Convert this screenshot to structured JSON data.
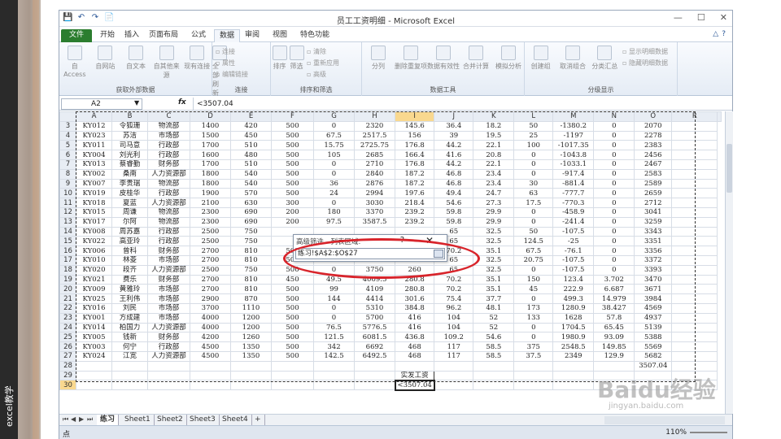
{
  "side": {
    "caption": "excel教学"
  },
  "window": {
    "title": "员工工资明细 - Microsoft Excel",
    "controls": [
      "—",
      "☐",
      "✕"
    ]
  },
  "qat": [
    "💾",
    "↶",
    "↷",
    "📄"
  ],
  "tabs": [
    {
      "label": "文件",
      "style": "file"
    },
    {
      "label": "开始"
    },
    {
      "label": "插入"
    },
    {
      "label": "页面布局"
    },
    {
      "label": "公式"
    },
    {
      "label": "数据",
      "active": true
    },
    {
      "label": "审阅"
    },
    {
      "label": "视图"
    },
    {
      "label": "特色功能"
    }
  ],
  "ribbon": {
    "groups": [
      {
        "label": "获取外部数据",
        "buttons": [
          "自 Access",
          "自网站",
          "自文本",
          "自其他来源",
          "现有连接"
        ]
      },
      {
        "label": "连接",
        "buttons": [
          "全部刷新"
        ],
        "small": [
          "连接",
          "属性",
          "编辑链接"
        ]
      },
      {
        "label": "排序和筛选",
        "buttons": [
          "排序",
          "筛选"
        ],
        "small": [
          "清除",
          "重新应用",
          "高级"
        ]
      },
      {
        "label": "数据工具",
        "buttons": [
          "分列",
          "删除重复项",
          "数据有效性",
          "合并计算",
          "模拟分析"
        ]
      },
      {
        "label": "分级显示",
        "buttons": [
          "创建组",
          "取消组合",
          "分类汇总"
        ],
        "small": [
          "显示明细数据",
          "隐藏明细数据"
        ]
      }
    ]
  },
  "formula_bar": {
    "name_box": "A2",
    "fx": "fx",
    "content": "<3507.04"
  },
  "columns": [
    "A",
    "B",
    "C",
    "D",
    "E",
    "F",
    "G",
    "H",
    "I",
    "J",
    "K",
    "L",
    "M",
    "N",
    "O",
    "R"
  ],
  "rows": [
    {
      "n": "3",
      "c": [
        "KY012",
        "令狐珊",
        "物流部",
        "1400",
        "420",
        "500",
        "0",
        "2320",
        "145.6",
        "36.4",
        "18.2",
        "50",
        "-1380.2",
        "0",
        "2070"
      ]
    },
    {
      "n": "4",
      "c": [
        "KY023",
        "苏洁",
        "市场部",
        "1500",
        "450",
        "500",
        "67.5",
        "2517.5",
        "156",
        "39",
        "19.5",
        "25",
        "-1197",
        "0",
        "2278"
      ]
    },
    {
      "n": "5",
      "c": [
        "KY011",
        "司马意",
        "行政部",
        "1700",
        "510",
        "500",
        "15.75",
        "2725.75",
        "176.8",
        "44.2",
        "22.1",
        "100",
        "-1017.35",
        "0",
        "2383"
      ]
    },
    {
      "n": "6",
      "c": [
        "KY004",
        "刘光利",
        "行政部",
        "1600",
        "480",
        "500",
        "105",
        "2685",
        "166.4",
        "41.6",
        "20.8",
        "0",
        "-1043.8",
        "0",
        "2456"
      ]
    },
    {
      "n": "7",
      "c": [
        "KY013",
        "蔡睿勤",
        "财务部",
        "1700",
        "510",
        "500",
        "0",
        "2710",
        "176.8",
        "44.2",
        "22.1",
        "0",
        "-1033.1",
        "0",
        "2467"
      ]
    },
    {
      "n": "8",
      "c": [
        "KY002",
        "桑南",
        "人力资源部",
        "1800",
        "540",
        "500",
        "0",
        "2840",
        "187.2",
        "46.8",
        "23.4",
        "0",
        "-917.4",
        "0",
        "2583"
      ]
    },
    {
      "n": "9",
      "c": [
        "KY007",
        "李贵瑞",
        "物流部",
        "1800",
        "540",
        "500",
        "36",
        "2876",
        "187.2",
        "46.8",
        "23.4",
        "30",
        "-881.4",
        "0",
        "2589"
      ]
    },
    {
      "n": "10",
      "c": [
        "KY019",
        "皮桂华",
        "行政部",
        "1900",
        "570",
        "500",
        "24",
        "2994",
        "197.6",
        "49.4",
        "24.7",
        "63",
        "-777.7",
        "0",
        "2659"
      ]
    },
    {
      "n": "11",
      "c": [
        "KY018",
        "夏蓝",
        "人力资源部",
        "2100",
        "630",
        "300",
        "0",
        "3030",
        "218.4",
        "54.6",
        "27.3",
        "17.5",
        "-770.3",
        "0",
        "2712"
      ]
    },
    {
      "n": "12",
      "c": [
        "KY015",
        "周谦",
        "物流部",
        "2300",
        "690",
        "200",
        "180",
        "3370",
        "239.2",
        "59.8",
        "29.9",
        "0",
        "-458.9",
        "0",
        "3041"
      ]
    },
    {
      "n": "13",
      "c": [
        "KY017",
        "尔阿",
        "物流部",
        "2300",
        "690",
        "200",
        "97.5",
        "3587.5",
        "239.2",
        "59.8",
        "29.9",
        "0",
        "-241.4",
        "0",
        "3259"
      ]
    },
    {
      "n": "14",
      "c": [
        "KY008",
        "周苏嘉",
        "行政部",
        "2500",
        "750",
        "",
        "",
        "",
        "",
        "65",
        "32.5",
        "50",
        "-107.5",
        "0",
        "3343"
      ]
    },
    {
      "n": "15",
      "c": [
        "KY022",
        "高亚玲",
        "行政部",
        "2500",
        "750",
        "",
        "",
        "",
        "",
        "65",
        "32.5",
        "124.5",
        "-25",
        "0",
        "3351"
      ]
    },
    {
      "n": "16",
      "c": [
        "KY006",
        "曾科",
        "财务部",
        "2700",
        "810",
        "500",
        "0",
        "3510",
        "280.8",
        "70.2",
        "35.1",
        "67.5",
        "-76.1",
        "0",
        "3356"
      ]
    },
    {
      "n": "17",
      "c": [
        "KY010",
        "林菱",
        "市场部",
        "2700",
        "810",
        "500",
        "0",
        "3750",
        "280.8",
        "65",
        "32.5",
        "20.75",
        "-107.5",
        "0",
        "3372"
      ]
    },
    {
      "n": "18",
      "c": [
        "KY020",
        "段齐",
        "人力资源部",
        "2500",
        "750",
        "500",
        "0",
        "3750",
        "260",
        "65",
        "32.5",
        "0",
        "-107.5",
        "0",
        "3393"
      ]
    },
    {
      "n": "19",
      "c": [
        "KY021",
        "费乐",
        "财务部",
        "2700",
        "810",
        "450",
        "49.5",
        "4009.5",
        "280.8",
        "70.2",
        "35.1",
        "150",
        "123.4",
        "3.702",
        "3470"
      ]
    },
    {
      "n": "20",
      "c": [
        "KY009",
        "黄雅玲",
        "市场部",
        "2700",
        "810",
        "500",
        "99",
        "4109",
        "280.8",
        "70.2",
        "35.1",
        "45",
        "222.9",
        "6.687",
        "3671"
      ]
    },
    {
      "n": "21",
      "c": [
        "KY025",
        "王利伟",
        "市场部",
        "2900",
        "870",
        "500",
        "144",
        "4414",
        "301.6",
        "75.4",
        "37.7",
        "0",
        "499.3",
        "14.979",
        "3984"
      ]
    },
    {
      "n": "22",
      "c": [
        "KY016",
        "刘民",
        "市场部",
        "3700",
        "1110",
        "500",
        "0",
        "5310",
        "384.8",
        "96.2",
        "48.1",
        "173",
        "1280.9",
        "38.427",
        "4569"
      ]
    },
    {
      "n": "23",
      "c": [
        "KY001",
        "方成建",
        "市场部",
        "4000",
        "1200",
        "500",
        "0",
        "5700",
        "416",
        "104",
        "52",
        "133",
        "1628",
        "57.8",
        "4937"
      ]
    },
    {
      "n": "24",
      "c": [
        "KY014",
        "柏国力",
        "人力资源部",
        "4000",
        "1200",
        "500",
        "76.5",
        "5776.5",
        "416",
        "104",
        "52",
        "0",
        "1704.5",
        "65.45",
        "5139"
      ]
    },
    {
      "n": "25",
      "c": [
        "KY005",
        "钱新",
        "财务部",
        "4200",
        "1260",
        "500",
        "121.5",
        "6081.5",
        "436.8",
        "109.2",
        "54.6",
        "0",
        "1980.9",
        "93.09",
        "5388"
      ]
    },
    {
      "n": "26",
      "c": [
        "KY003",
        "何宁",
        "行政部",
        "4500",
        "1350",
        "500",
        "342",
        "6692",
        "468",
        "117",
        "58.5",
        "375",
        "2548.5",
        "149.85",
        "5569"
      ]
    },
    {
      "n": "27",
      "c": [
        "KY024",
        "江宽",
        "人力资源部",
        "4500",
        "1350",
        "500",
        "142.5",
        "6492.5",
        "468",
        "117",
        "58.5",
        "37.5",
        "2349",
        "129.9",
        "5682"
      ]
    },
    {
      "n": "28",
      "c": [
        "",
        "",
        "",
        "",
        "",
        "",
        "",
        "",
        "",
        "",
        "",
        "",
        "",
        "",
        "3507.04"
      ]
    },
    {
      "n": "29",
      "c": [
        "",
        "",
        "",
        "",
        "",
        "",
        "",
        "",
        "实发工资",
        "",
        "",
        "",
        "",
        "",
        ""
      ]
    },
    {
      "n": "30",
      "c": [
        "",
        "",
        "",
        "",
        "",
        "",
        "",
        "",
        "<3507.04",
        "",
        "",
        "",
        "",
        "",
        ""
      ]
    }
  ],
  "dialog": {
    "title": "高级筛选 - 列表区域:",
    "help": "?",
    "close": "✕",
    "value": "练习!$A$2:$O$27"
  },
  "sheet_tabs": [
    "练习",
    "Sheet1",
    "Sheet2",
    "Sheet3",
    "Sheet4"
  ],
  "sheet_nav": [
    "⏮",
    "◀",
    "▶",
    "⏭"
  ],
  "status": {
    "mode": "点",
    "zoom": "110%"
  },
  "watermark": {
    "text": "Baidu经验",
    "sub": "jingyan.baidu.com"
  },
  "colors": {
    "file_tab": "#2b7d2f",
    "annotation": "#d8242b",
    "selected_header": "#f9d88f"
  }
}
